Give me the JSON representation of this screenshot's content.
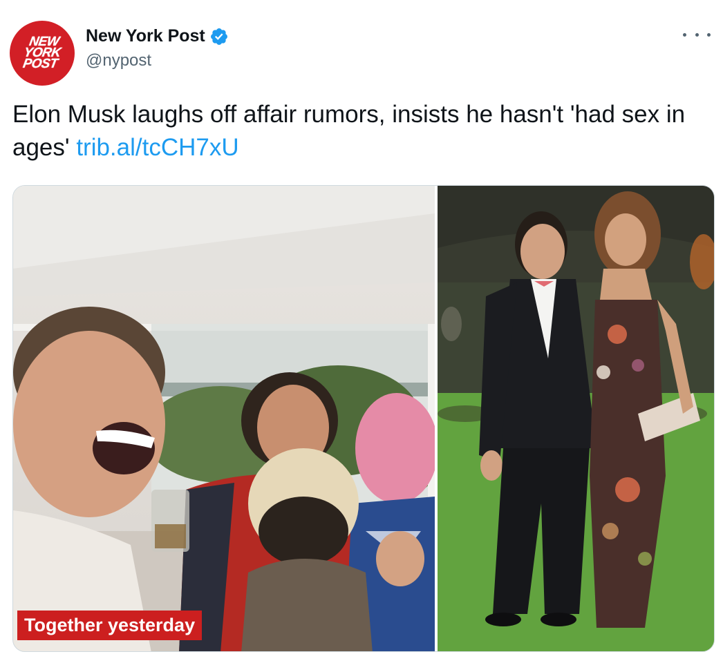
{
  "author": {
    "display_name": "New York Post",
    "handle": "@nypost",
    "avatar_logo_lines": [
      "NEW",
      "YORK",
      "POST"
    ],
    "verified": true
  },
  "tweet": {
    "text": "Elon Musk laughs off affair rumors, insists he hasn't 'had sex in ages'",
    "link_text": "trib.al/tcCH7xU"
  },
  "media": {
    "left_photo_caption": "Together yesterday"
  },
  "colors": {
    "brand_red": "#d21f26",
    "link_blue": "#1d9bf0",
    "secondary_text": "#536471",
    "caption_red": "#cc1f1f"
  },
  "icons": {
    "verified": "verified-badge-icon",
    "more": "more-options-icon"
  }
}
